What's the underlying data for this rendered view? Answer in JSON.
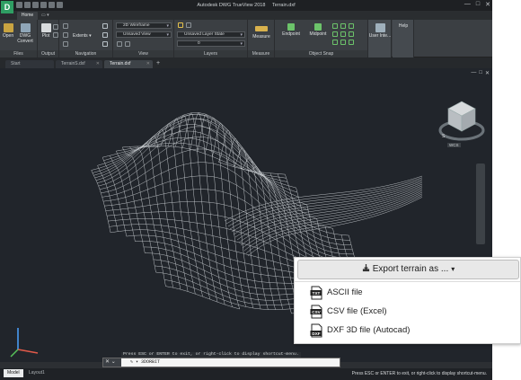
{
  "window": {
    "app_name": "Autodesk DWG TrueView 2018",
    "file_name": "Terrain.dxf",
    "minimize_glyph": "—",
    "maximize_glyph": "□",
    "close_glyph": "✕"
  },
  "ribbon": {
    "tabs": [
      {
        "label": "Home"
      }
    ],
    "tab_extra": "▭ ▾",
    "panels": {
      "files": "Files",
      "output": "Output",
      "navigation": "Navigation",
      "view": "View",
      "layers": "Layers",
      "measure": "Measure",
      "object_snap": "Object Snap"
    },
    "buttons": {
      "open": "Open",
      "dwg_convert": "DWG Convert",
      "plot": "Plot",
      "extents": "Extents",
      "measure": "Measure",
      "endpoint": "Endpoint",
      "midpoint": "Midpoint",
      "user_interface": "User Inte...",
      "help": "Help"
    },
    "dropdowns": {
      "visual_style": "2D Wireframe",
      "named_view": "Unsaved View",
      "layer_state": "Unsaved Layer State",
      "layer": "0"
    }
  },
  "doc_tabs": [
    {
      "label": "Start",
      "closable": false
    },
    {
      "label": "TerrainS.dxf",
      "closable": true
    },
    {
      "label": "Terrain.dxf",
      "closable": true
    }
  ],
  "doc_tab_add": "+",
  "viewport": {
    "controls": [
      "—",
      "□",
      "✕"
    ],
    "viewcube_wcs": "WCS",
    "viewcube_compass_s": "S"
  },
  "command": {
    "hint": "Press ESC or ENTER to exit, or right-click to display shortcut-menu.",
    "buttons": "✕ ⌄",
    "prompt": "✎ ▾ 3DORBIT"
  },
  "status": {
    "tabs": [
      {
        "label": "Model"
      },
      {
        "label": "Layout1"
      }
    ],
    "message": "Press ESC or ENTER to exit, or right-click to display shortcut-menu."
  },
  "export": {
    "button_label": "Export terrain as ...",
    "caret": "▾",
    "items": [
      {
        "label": "ASCII file",
        "icon": "txt-file-icon",
        "badge": "TXT"
      },
      {
        "label": "CSV file (Excel)",
        "icon": "csv-file-icon",
        "badge": "CSV"
      },
      {
        "label": "DXF 3D file (Autocad)",
        "icon": "dxf-file-icon",
        "badge": "DXF"
      }
    ]
  },
  "colors": {
    "viewport_bg": "#21252b",
    "ribbon_bg": "#3b3f43",
    "app_logo": "#2f9e63",
    "mesh": "#e8ecef"
  }
}
